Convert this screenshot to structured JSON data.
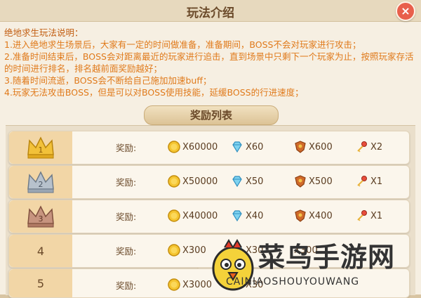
{
  "header": {
    "title": "玩法介绍",
    "close_label": "×"
  },
  "description": {
    "heading": "绝地求生玩法说明：",
    "lines": [
      "1.进入绝地求生场景后，大家有一定的时间做准备，准备期间，BOSS不会对玩家进行攻击；",
      "2.准备时间结束后，BOSS会对距离最近的玩家进行追击，直到场景中只剩下一个玩家为止，按照玩家存活的时间进行排名，排名越前面奖励越好；",
      "3.随着时间流逝，BOSS会不断给自己施加加速buff；",
      "4.玩家无法攻击BOSS，但是可以对BOSS使用技能，延缓BOSS的行进速度；"
    ]
  },
  "rewards": {
    "tab_label": "奖励列表",
    "reward_label": "奖励:",
    "rows": [
      {
        "rank": "1",
        "gold": "X60000",
        "diamond": "X60",
        "shield": "X600",
        "key": "X2"
      },
      {
        "rank": "2",
        "gold": "X50000",
        "diamond": "X50",
        "shield": "X500",
        "key": "X1"
      },
      {
        "rank": "3",
        "gold": "X40000",
        "diamond": "X40",
        "shield": "X400",
        "key": "X1"
      },
      {
        "rank": "4",
        "gold": "X300",
        "diamond": "X30",
        "shield": "X300",
        "key": ""
      },
      {
        "rank": "5",
        "gold": "X3000",
        "diamond": "X30",
        "shield": "",
        "key": ""
      }
    ]
  },
  "watermark": {
    "text": "菜鸟手游网",
    "sub": "CAINIAOSHOUYOUWANG"
  },
  "colors": {
    "accent": "#e07a1b",
    "close": "#e85f4c",
    "rank_bg": "#f2d6a6"
  }
}
